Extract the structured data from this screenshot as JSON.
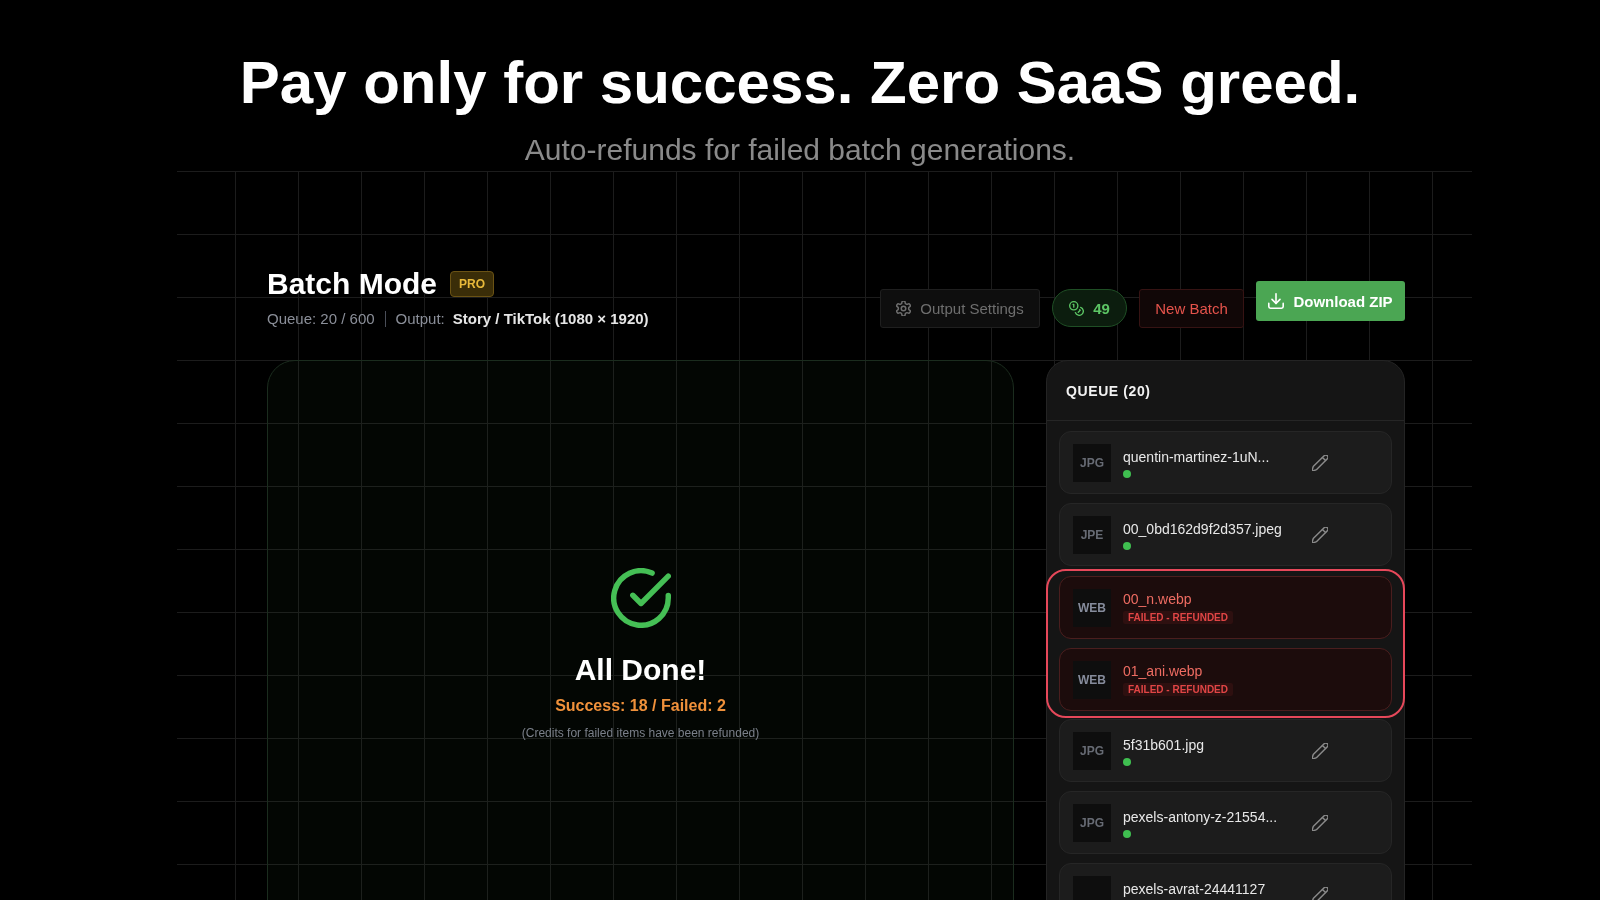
{
  "headline": "Pay only for success. Zero SaaS greed.",
  "subheadline": "Auto-refunds for failed batch generations.",
  "batch": {
    "title": "Batch Mode",
    "badge": "PRO",
    "queue_label": "Queue: 20 / 600",
    "output_label": "Output:",
    "output_value": "Story / TikTok (1080 × 1920)"
  },
  "toolbar": {
    "settings_button": "Output Settings",
    "credits": "49",
    "new_batch_button": "New Batch",
    "download_button": "Download ZIP"
  },
  "result": {
    "title": "All Done!",
    "summary": "Success: 18 / Failed: 2",
    "note": "(Credits for failed items have been refunded)"
  },
  "queue": {
    "title": "QUEUE (20)",
    "items": [
      {
        "file_type": "JPG",
        "name": "quentin-martinez-1uN...",
        "failed": false,
        "highlighted": false
      },
      {
        "file_type": "JPE",
        "name": "00_0bd162d9f2d357.jpeg",
        "failed": false,
        "highlighted": false
      },
      {
        "file_type": "WEB",
        "name": "00_n.webp",
        "failed": true,
        "badge": "FAILED - REFUNDED",
        "highlighted": true
      },
      {
        "file_type": "WEB",
        "name": "01_ani.webp",
        "failed": true,
        "badge": "FAILED - REFUNDED",
        "highlighted": true
      },
      {
        "file_type": "JPG",
        "name": "5f31b601.jpg",
        "failed": false,
        "highlighted": false
      },
      {
        "file_type": "JPG",
        "name": "pexels-antony-z-21554...",
        "failed": false,
        "highlighted": false
      },
      {
        "name": "pexels-avrat-24441127",
        "failed": false,
        "highlighted": false
      }
    ]
  }
}
